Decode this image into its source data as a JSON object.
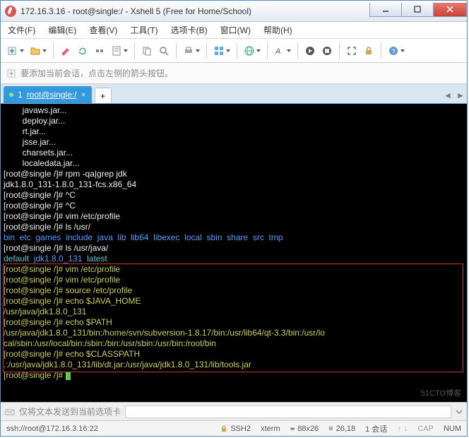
{
  "window": {
    "title": "172.16.3.16 - root@single:/ - Xshell 5 (Free for Home/School)"
  },
  "menu": {
    "file": "文件(F)",
    "edit": "编辑(E)",
    "view": "查看(V)",
    "tools": "工具(T)",
    "tab": "选项卡(B)",
    "window": "窗口(W)",
    "help": "帮助(H)"
  },
  "info": {
    "hint": "要添加当前会话，点击左侧的箭头按钮。"
  },
  "tabs": {
    "active": {
      "index": "1",
      "label": "root@single:/"
    }
  },
  "terminal": {
    "pre": [
      "        javaws.jar...",
      "        deploy.jar...",
      "        rt.jar...",
      "        jsse.jar...",
      "        charsets.jar...",
      "        localedata.jar..."
    ],
    "p1": "[root@single /]# ",
    "c1": "rpm -qa|grep jdk",
    "l2": "jdk1.8.0_131-1.8.0_131-fcs.x86_64",
    "p3": "[root@single /]# ",
    "c3": "^C",
    "p4": "[root@single /]# ",
    "c4": "^C",
    "p5": "[root@single /]# ",
    "c5": "vim /etc/profile",
    "p6": "[root@single /]# ",
    "c6": "ls /usr/",
    "ls1": "bin  etc  games  include  java  lib  lib64  libexec  local  sbin  share  src  tmp",
    "p7": "[root@single /]# ",
    "c7": "ls /usr/java/",
    "ls2a": "default  ",
    "ls2b": "jdk1.8.0_131  ",
    "ls2c": "latest",
    "p8": "[root@single /]# ",
    "c8": "vim /etc/profile",
    "p9": "[root@single /]# ",
    "c9": "vim /etc/profile",
    "p10": "[root@single /]# ",
    "c10": "source /etc/profile",
    "p11": "[root@single /]# ",
    "c11": "echo $JAVA_HOME",
    "l12": "/usr/java/jdk1.8.0_131",
    "p13": "[root@single /]# ",
    "c13": "echo $PATH",
    "l14": "/usr/java/jdk1.8.0_131/bin:/home/svn/subversion-1.8.17/bin:/usr/lib64/qt-3.3/bin:/usr/lo",
    "l15": "cal/sbin:/usr/local/bin:/sbin:/bin:/usr/sbin:/usr/bin:/root/bin",
    "p16": "[root@single /]# ",
    "c16": "echo $CLASSPATH",
    "l17": ".:/usr/java/jdk1.8.0_131/lib/dt.jar:/usr/java/jdk1.8.0_131/lib/tools.jar",
    "p18": "[root@single /]# "
  },
  "sendbar": {
    "hint": "仅将文本发送到当前选项卡"
  },
  "status": {
    "conn": "ssh://root@172.16.3.16:22",
    "proto": "SSH2",
    "term": "xterm",
    "size": "88x26",
    "cursor": "26,18",
    "sess": "1 会话",
    "caps": "CAP",
    "num": "NUM"
  },
  "watermark": "51CTO博客"
}
